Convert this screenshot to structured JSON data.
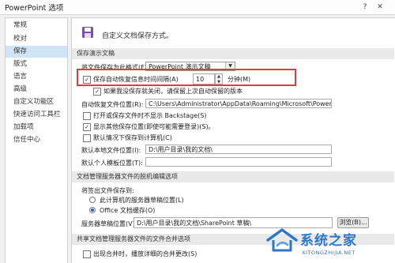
{
  "window": {
    "title": "PowerPoint 选项",
    "help_glyph": "?",
    "close_glyph": "✕"
  },
  "sidebar": {
    "items": [
      {
        "label": "常规",
        "selected": false
      },
      {
        "label": "校对",
        "selected": false
      },
      {
        "label": "保存",
        "selected": true
      },
      {
        "label": "版式",
        "selected": false
      },
      {
        "label": "语言",
        "selected": false
      },
      {
        "label": "高级",
        "selected": false
      },
      {
        "label": "自定义功能区",
        "selected": false
      },
      {
        "label": "快速访问工具栏",
        "selected": false
      },
      {
        "label": "加载项",
        "selected": false
      },
      {
        "label": "信任中心",
        "selected": false
      }
    ]
  },
  "header": {
    "text": "自定义文档保存方式。",
    "icon": "save-icon"
  },
  "save_presentations": {
    "section_title": "保存演示文稿",
    "format_label": "将文件保存为此格式(F):",
    "format_value": "PowerPoint 演示文稿",
    "autorecover_label": "保存自动恢复信息时间间隔(A)",
    "autorecover_checked": true,
    "autorecover_minutes": "10",
    "minutes_label": "分钟(M)",
    "keep_last_label": "如果我没保存就关闭，请保留上次自动保留的版本",
    "keep_last_checked": true,
    "autorecover_location_label": "自动恢复文件位置(R):",
    "autorecover_location_value": "C:\\Users\\Administrator\\AppData\\Roaming\\Microsoft\\PowerPoint\\",
    "backstage_label": "打开或保存文件时不显示 Backstage(S)",
    "backstage_checked": false,
    "show_other_locations_label": "显示其他保存位置(即使可能需要登录)(S)。",
    "show_other_locations_checked": true,
    "default_to_computer_label": "默认情况下保存到计算机(C)",
    "default_to_computer_checked": false,
    "default_local_label": "默认本地文件位置(I):",
    "default_local_value": "D:\\用户目录\\我的文档\\",
    "personal_templates_label": "默认个人模板位置(T):",
    "personal_templates_value": ""
  },
  "offline_editing": {
    "section_title": "文档管理服务器文件的脱机编辑选项",
    "checkout_label": "将签出文件保存到:",
    "option_server_label": "此计算机的服务器草稿位置(L)",
    "option_server_selected": false,
    "option_office_label": "Office 文档缓存(O)",
    "option_office_selected": true,
    "drafts_label": "服务器草稿位置(V):",
    "drafts_value": "D:\\用户目录\\我的文档\\SharePoint 草稿\\",
    "browse_label": "浏览(B)..."
  },
  "merge": {
    "section_title": "共享文档管理服务器文件的文件合并选项",
    "merge_label": "出现合并时，播放详细的合并更改(S)",
    "merge_checked": false
  },
  "watermark": {
    "main": "系统之家",
    "sub": "XITONGZHIJIA.NET"
  },
  "colors": {
    "highlight": "#e23b3b",
    "selection": "#cfe4f7",
    "watermark": "#2e76c6"
  }
}
